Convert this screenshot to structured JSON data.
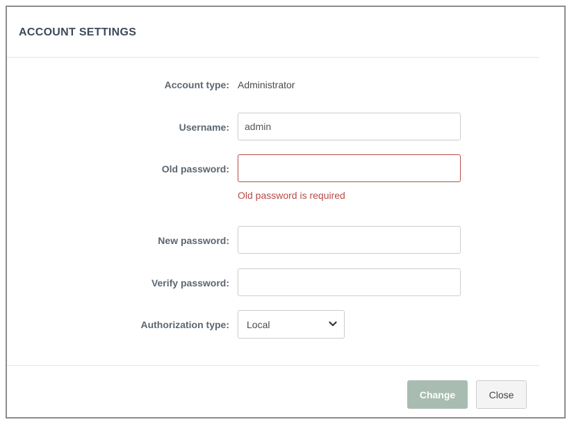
{
  "dialog": {
    "title": "ACCOUNT SETTINGS"
  },
  "form": {
    "account_type": {
      "label": "Account type:",
      "value": "Administrator"
    },
    "username": {
      "label": "Username:",
      "value": "admin"
    },
    "old_password": {
      "label": "Old password:",
      "value": "",
      "error": "Old password is required"
    },
    "new_password": {
      "label": "New password:",
      "value": ""
    },
    "verify_password": {
      "label": "Verify password:",
      "value": ""
    },
    "authorization_type": {
      "label": "Authorization type:",
      "selected": "Local",
      "icon": "chevron-down-icon"
    }
  },
  "footer": {
    "change_label": "Change",
    "close_label": "Close"
  },
  "colors": {
    "error": "#b94a48",
    "primary_button_disabled": "#a9bcb2",
    "title": "#3d4a5a"
  }
}
